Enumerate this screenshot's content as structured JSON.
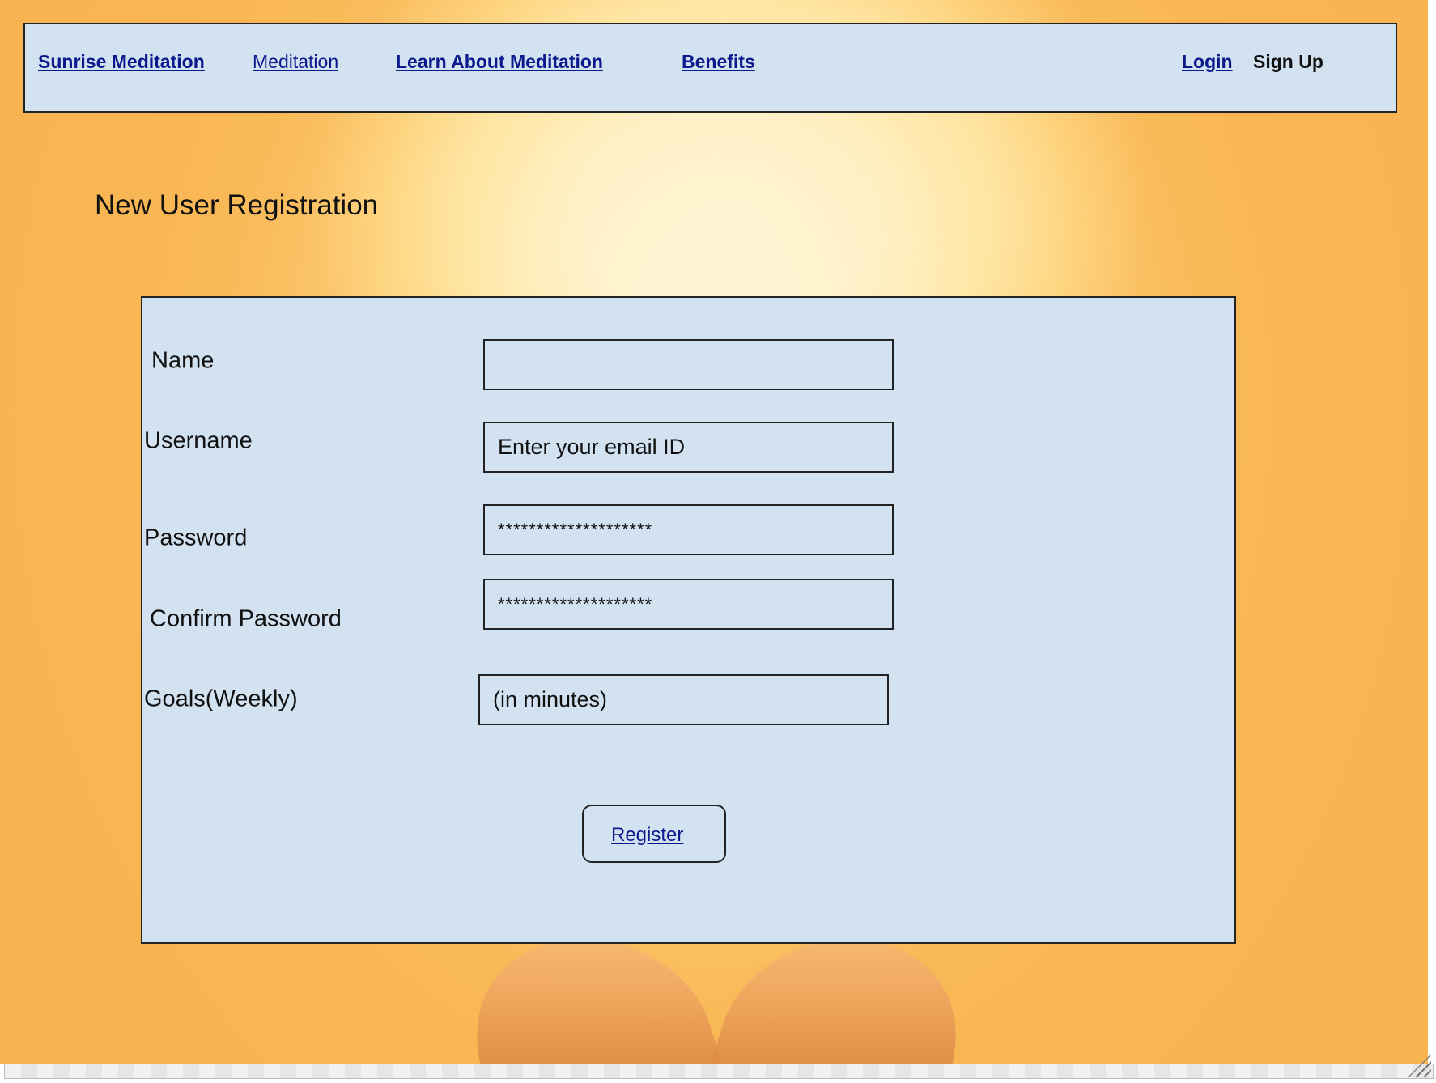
{
  "nav": {
    "brand": "Sunrise Meditation",
    "items": [
      "Meditation",
      "Learn About Meditation",
      "Benefits"
    ],
    "login": "Login",
    "signup": "Sign Up"
  },
  "page": {
    "title": "New User Registration"
  },
  "form": {
    "fields": [
      {
        "label": "Name",
        "value": "",
        "placeholder": ""
      },
      {
        "label": "Username",
        "value": "",
        "placeholder": "Enter your email ID"
      },
      {
        "label": "Password",
        "value": "********************"
      },
      {
        "label": "Confirm Password",
        "value": "********************"
      },
      {
        "label": "Goals(Weekly)",
        "value": "",
        "placeholder": "(in minutes)"
      }
    ],
    "submit_label": "Register"
  },
  "colors": {
    "panel": "#d3e2f1",
    "link": "#0a1a8c",
    "background_warm": "#f8b450"
  }
}
